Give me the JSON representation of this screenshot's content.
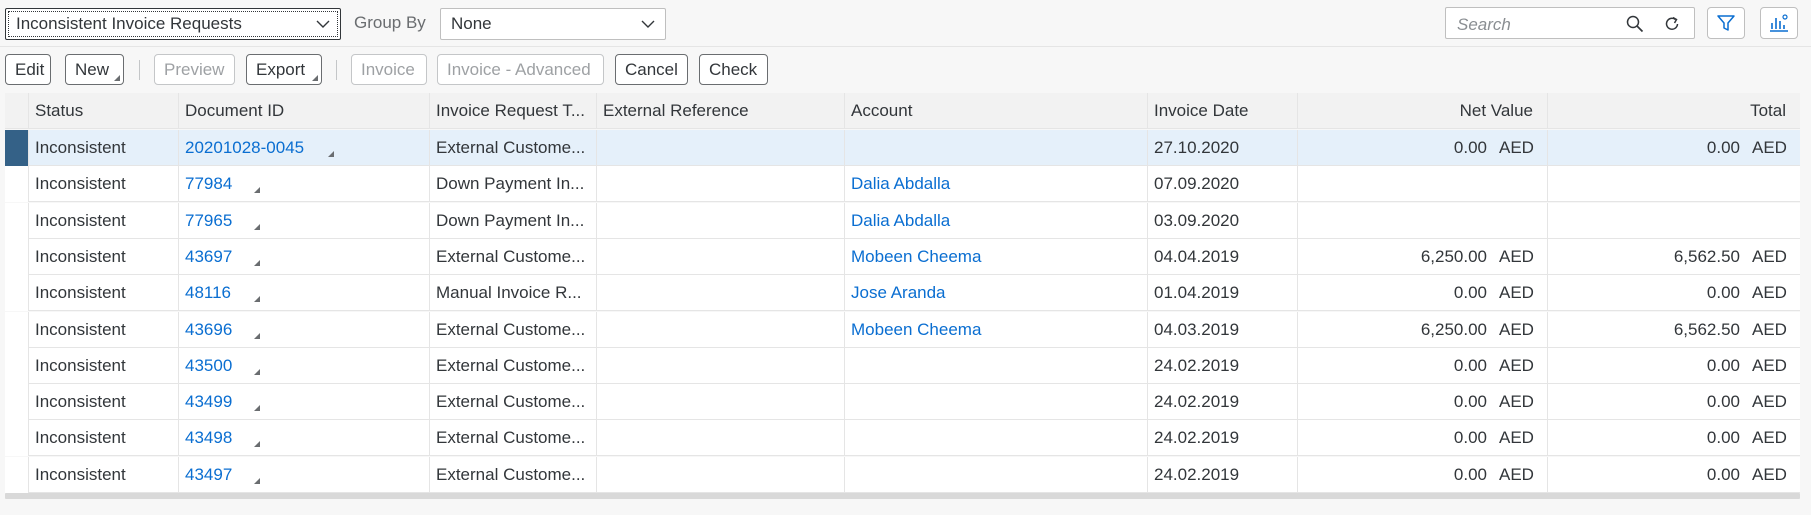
{
  "header": {
    "view_select": "Inconsistent Invoice Requests",
    "group_by_label": "Group By",
    "group_by_value": "None",
    "search_placeholder": "Search"
  },
  "toolbar": {
    "edit": "Edit",
    "new": "New",
    "preview": "Preview",
    "export": "Export",
    "invoice": "Invoice",
    "invoice_advanced": "Invoice - Advanced",
    "cancel": "Cancel",
    "check": "Check"
  },
  "table": {
    "columns": {
      "status": "Status",
      "document_id": "Document ID",
      "invoice_request_type": "Invoice Request T...",
      "external_reference": "External Reference",
      "account": "Account",
      "invoice_date": "Invoice Date",
      "net_value": "Net Value",
      "total": "Total"
    },
    "rows": [
      {
        "status": "Inconsistent",
        "document_id": "20201028-0045",
        "type": "External Custome...",
        "external_reference": "",
        "account": "",
        "invoice_date": "27.10.2020",
        "net_value": "0.00",
        "net_unit": "AED",
        "total": "0.00",
        "total_unit": "AED"
      },
      {
        "status": "Inconsistent",
        "document_id": "77984",
        "type": "Down Payment In...",
        "external_reference": "",
        "account": "Dalia Abdalla",
        "invoice_date": "07.09.2020",
        "net_value": "",
        "net_unit": "",
        "total": "",
        "total_unit": ""
      },
      {
        "status": "Inconsistent",
        "document_id": "77965",
        "type": "Down Payment In...",
        "external_reference": "",
        "account": "Dalia Abdalla",
        "invoice_date": "03.09.2020",
        "net_value": "",
        "net_unit": "",
        "total": "",
        "total_unit": ""
      },
      {
        "status": "Inconsistent",
        "document_id": "43697",
        "type": "External Custome...",
        "external_reference": "",
        "account": "Mobeen Cheema",
        "invoice_date": "04.04.2019",
        "net_value": "6,250.00",
        "net_unit": "AED",
        "total": "6,562.50",
        "total_unit": "AED"
      },
      {
        "status": "Inconsistent",
        "document_id": "48116",
        "type": "Manual Invoice R...",
        "external_reference": "",
        "account": "Jose Aranda",
        "invoice_date": "01.04.2019",
        "net_value": "0.00",
        "net_unit": "AED",
        "total": "0.00",
        "total_unit": "AED"
      },
      {
        "status": "Inconsistent",
        "document_id": "43696",
        "type": "External Custome...",
        "external_reference": "",
        "account": "Mobeen Cheema",
        "invoice_date": "04.03.2019",
        "net_value": "6,250.00",
        "net_unit": "AED",
        "total": "6,562.50",
        "total_unit": "AED"
      },
      {
        "status": "Inconsistent",
        "document_id": "43500",
        "type": "External Custome...",
        "external_reference": "",
        "account": "",
        "invoice_date": "24.02.2019",
        "net_value": "0.00",
        "net_unit": "AED",
        "total": "0.00",
        "total_unit": "AED"
      },
      {
        "status": "Inconsistent",
        "document_id": "43499",
        "type": "External Custome...",
        "external_reference": "",
        "account": "",
        "invoice_date": "24.02.2019",
        "net_value": "0.00",
        "net_unit": "AED",
        "total": "0.00",
        "total_unit": "AED"
      },
      {
        "status": "Inconsistent",
        "document_id": "43498",
        "type": "External Custome...",
        "external_reference": "",
        "account": "",
        "invoice_date": "24.02.2019",
        "net_value": "0.00",
        "net_unit": "AED",
        "total": "0.00",
        "total_unit": "AED"
      },
      {
        "status": "Inconsistent",
        "document_id": "43497",
        "type": "External Custome...",
        "external_reference": "",
        "account": "",
        "invoice_date": "24.02.2019",
        "net_value": "0.00",
        "net_unit": "AED",
        "total": "0.00",
        "total_unit": "AED"
      }
    ]
  },
  "colors": {
    "link": "#0a6ed1",
    "selected_row": "#e5f0fa",
    "selection_marker": "#346187",
    "border": "#e5e5e5"
  },
  "icons": [
    "chevron-down-icon",
    "search-icon",
    "refresh-icon",
    "filter-icon",
    "table-settings-icon",
    "menu-indicator-icon"
  ]
}
